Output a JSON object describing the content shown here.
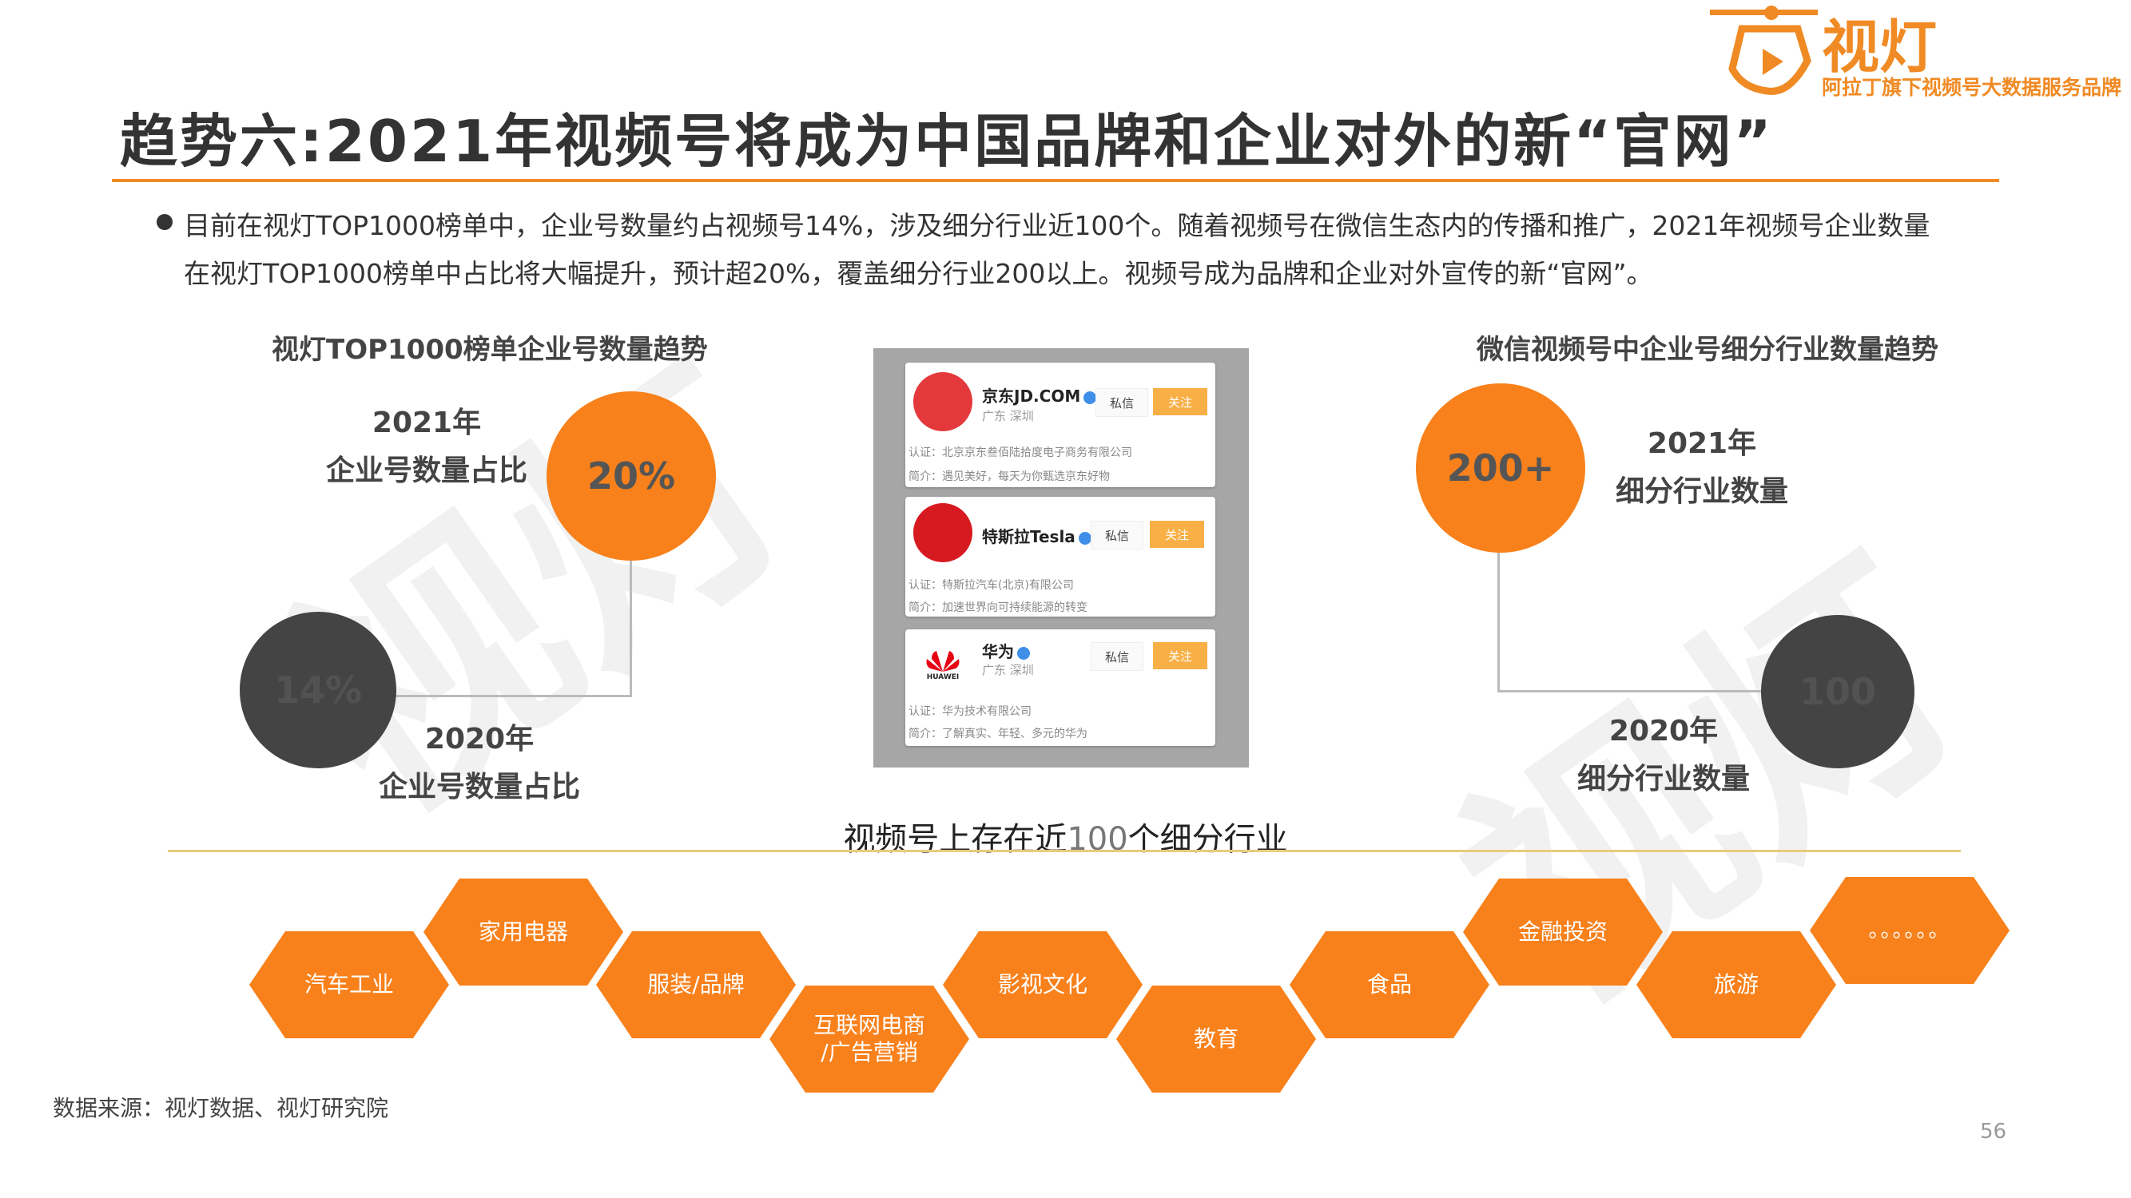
{
  "brand": {
    "name": "视灯",
    "tagline": "阿拉丁旗下视频号大数据服务品牌",
    "color": "#f08a24"
  },
  "title": "趋势六:2021年视频号将成为中国品牌和企业对外的新“官网”",
  "bullet": {
    "line1": "目前在视灯TOP1000榜单中，企业号数量约占视频号14%，涉及细分行业近100个。随着视频号在微信生态内的传播和推广，2021年视频号企业数量",
    "line2": "在视灯TOP1000榜单中占比将大幅提升，预计超20%，覆盖细分行业200以上。视频号成为品牌和企业对外宣传的新“官网”。"
  },
  "left_panel": {
    "heading": "视灯TOP1000榜单企业号数量趋势",
    "year_2021": "2021年",
    "label_2021": "企业号数量占比",
    "value_2021": "20%",
    "year_2020": "2020年",
    "label_2020": "企业号数量占比",
    "value_2020": "14%"
  },
  "right_panel": {
    "heading": "微信视频号中企业号细分行业数量趋势",
    "year_2021": "2021年",
    "label_2021": "细分行业数量",
    "value_2021": "200+",
    "year_2020": "2020年",
    "label_2020": "细分行业数量",
    "value_2020": "100"
  },
  "accounts": [
    {
      "name": "京东JD.COM",
      "location": "广东 深圳",
      "message": "私信",
      "follow": "关注",
      "cert": "认证：北京京东叁佰陆拾度电子商务有限公司",
      "intro": "简介：遇见美好，每天为你甄选京东好物"
    },
    {
      "name": "特斯拉Tesla",
      "location": "",
      "message": "私信",
      "follow": "关注",
      "cert": "认证：特斯拉汽车(北京)有限公司",
      "intro": "简介：加速世界向可持续能源的转变"
    },
    {
      "name": "华为",
      "location": "广东 深圳",
      "logo_text": "HUAWEI",
      "message": "私信",
      "follow": "关注",
      "cert": "认证：华为技术有限公司",
      "intro": "简介：了解真实、年轻、多元的华为"
    }
  ],
  "industries": {
    "heading_prefix": "视频号上存在近",
    "heading_number": "100",
    "heading_suffix": "个细分行业",
    "items": [
      "汽车工业",
      "家用电器",
      "服装/品牌",
      "互联网电商\n/广告营销",
      "影视文化",
      "教育",
      "食品",
      "金融投资",
      "旅游",
      "。。。。。。"
    ]
  },
  "source": "数据来源：视灯数据、视灯研究院",
  "page_number": "56",
  "colors": {
    "accent": "#f8811c",
    "dark": "#444444",
    "divider": "#e8cc7a"
  }
}
